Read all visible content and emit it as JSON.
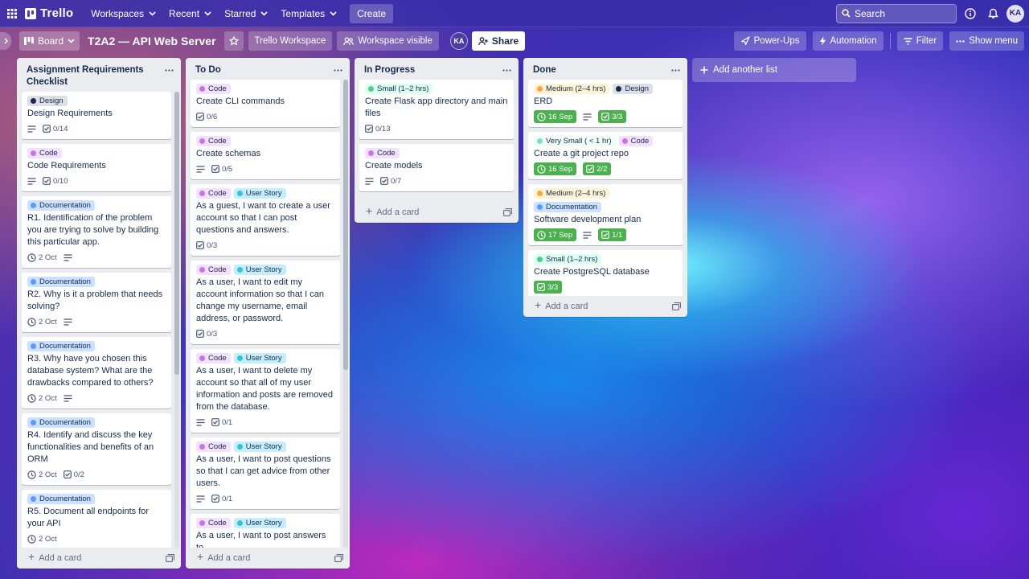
{
  "nav": {
    "logo": "Trello",
    "menus": [
      "Workspaces",
      "Recent",
      "Starred",
      "Templates"
    ],
    "create": "Create",
    "search_placeholder": "Search",
    "avatar": "KA"
  },
  "board": {
    "view": "Board",
    "title": "T2A2 — API Web Server",
    "workspace": "Trello Workspace",
    "visibility": "Workspace visible",
    "member": "KA",
    "share": "Share",
    "power_ups": "Power-Ups",
    "automation": "Automation",
    "filter": "Filter",
    "show_menu": "Show menu"
  },
  "labels_legend": {
    "Design": "#172b4d",
    "Code": "#c774e8",
    "Documentation": "#579dff",
    "User Story": "#2fc7d8",
    "Small (1–2 hrs)": "#4bce97",
    "Medium (2–4 hrs)": "#faa53d",
    "Very Small ( < 1 hr)": "#7ee2b8"
  },
  "lists": [
    {
      "title": "Assignment Requirements Checklist",
      "add_card": "Add a card",
      "cards": [
        {
          "labels": [
            {
              "name": "Design",
              "bg": "#dcdfe4",
              "dot": "#172b4d"
            }
          ],
          "title": "Design Requirements",
          "desc": true,
          "checklist": "0/14"
        },
        {
          "labels": [
            {
              "name": "Code",
              "bg": "#f3e0fa",
              "dot": "#c774e8"
            }
          ],
          "title": "Code Requirements",
          "desc": true,
          "checklist": "0/10"
        },
        {
          "labels": [
            {
              "name": "Documentation",
              "bg": "#cce0ff",
              "dot": "#579dff"
            }
          ],
          "title": "R1. Identification of the problem you are trying to solve by building this particular app.",
          "due": "2 Oct",
          "desc": true
        },
        {
          "labels": [
            {
              "name": "Documentation",
              "bg": "#cce0ff",
              "dot": "#579dff"
            }
          ],
          "title": "R2. Why is it a problem that needs solving?",
          "due": "2 Oct",
          "desc": true
        },
        {
          "labels": [
            {
              "name": "Documentation",
              "bg": "#cce0ff",
              "dot": "#579dff"
            }
          ],
          "title": "R3. Why have you chosen this database system? What are the drawbacks compared to others?",
          "due": "2 Oct",
          "desc": true
        },
        {
          "labels": [
            {
              "name": "Documentation",
              "bg": "#cce0ff",
              "dot": "#579dff"
            }
          ],
          "title": "R4. Identify and discuss the key functionalities and benefits of an ORM",
          "due": "2 Oct",
          "checklist": "0/2"
        },
        {
          "labels": [
            {
              "name": "Documentation",
              "bg": "#cce0ff",
              "dot": "#579dff"
            }
          ],
          "title": "R5. Document all endpoints for your API",
          "due": "2 Oct"
        }
      ]
    },
    {
      "title": "To Do",
      "add_card": "Add a card",
      "cards": [
        {
          "labels": [
            {
              "name": "Code",
              "bg": "#f3e0fa",
              "dot": "#c774e8"
            }
          ],
          "title": "Create CLI commands",
          "checklist": "0/6"
        },
        {
          "labels": [
            {
              "name": "Code",
              "bg": "#f3e0fa",
              "dot": "#c774e8"
            }
          ],
          "title": "Create schemas",
          "desc": true,
          "checklist": "0/5"
        },
        {
          "labels": [
            {
              "name": "Code",
              "bg": "#f3e0fa",
              "dot": "#c774e8"
            },
            {
              "name": "User Story",
              "bg": "#c6edfb",
              "dot": "#2fc7d8"
            }
          ],
          "title": "As a guest, I want to create a user account so that I can post questions and answers.",
          "checklist": "0/3"
        },
        {
          "labels": [
            {
              "name": "Code",
              "bg": "#f3e0fa",
              "dot": "#c774e8"
            },
            {
              "name": "User Story",
              "bg": "#c6edfb",
              "dot": "#2fc7d8"
            }
          ],
          "title": "As a user, I want to edit my account information so that I can change my username, email address, or password.",
          "checklist": "0/3"
        },
        {
          "labels": [
            {
              "name": "Code",
              "bg": "#f3e0fa",
              "dot": "#c774e8"
            },
            {
              "name": "User Story",
              "bg": "#c6edfb",
              "dot": "#2fc7d8"
            }
          ],
          "title": "As a user, I want to delete my account so that all of my user information and posts are removed from the database.",
          "desc": true,
          "checklist": "0/1"
        },
        {
          "labels": [
            {
              "name": "Code",
              "bg": "#f3e0fa",
              "dot": "#c774e8"
            },
            {
              "name": "User Story",
              "bg": "#c6edfb",
              "dot": "#2fc7d8"
            }
          ],
          "title": "As a user, I want to post questions so that I can get advice from other users.",
          "desc": true,
          "checklist": "0/1"
        },
        {
          "labels": [
            {
              "name": "Code",
              "bg": "#f3e0fa",
              "dot": "#c774e8"
            },
            {
              "name": "User Story",
              "bg": "#c6edfb",
              "dot": "#2fc7d8"
            }
          ],
          "title": "As a user, I want to post answers to"
        }
      ]
    },
    {
      "title": "In Progress",
      "add_card": "Add a card",
      "cards": [
        {
          "labels": [
            {
              "name": "Small (1–2 hrs)",
              "bg": "#dcfff1",
              "dot": "#4bce97"
            }
          ],
          "title": "Create Flask app directory and main files",
          "checklist": "0/13"
        },
        {
          "labels": [
            {
              "name": "Code",
              "bg": "#f3e0fa",
              "dot": "#c774e8"
            }
          ],
          "title": "Create models",
          "desc": true,
          "checklist": "0/7"
        }
      ]
    },
    {
      "title": "Done",
      "add_card": "Add a card",
      "cards": [
        {
          "labels": [
            {
              "name": "Medium (2–4 hrs)",
              "bg": "#fff3d6",
              "dot": "#faa53d"
            },
            {
              "name": "Design",
              "bg": "#dcdfe4",
              "dot": "#172b4d"
            }
          ],
          "title": "ERD",
          "due": "16 Sep",
          "due_done": true,
          "desc": true,
          "checklist": "3/3",
          "checklist_done": true
        },
        {
          "labels": [
            {
              "name": "Very Small ( < 1 hr)",
              "bg": "#f0fdf6",
              "dot": "#7ee2b8"
            },
            {
              "name": "Code",
              "bg": "#f3e0fa",
              "dot": "#c774e8"
            }
          ],
          "title": "Create a git project repo",
          "due": "16 Sep",
          "due_done": true,
          "checklist": "2/2",
          "checklist_done": true
        },
        {
          "labels": [
            {
              "name": "Medium (2–4 hrs)",
              "bg": "#fff3d6",
              "dot": "#faa53d"
            },
            {
              "name": "Documentation",
              "bg": "#cce0ff",
              "dot": "#579dff"
            }
          ],
          "title": "Software development plan",
          "due": "17 Sep",
          "due_done": true,
          "desc": true,
          "checklist": "1/1",
          "checklist_done": true
        },
        {
          "labels": [
            {
              "name": "Small (1–2 hrs)",
              "bg": "#dcfff1",
              "dot": "#4bce97"
            }
          ],
          "title": "Create PostgreSQL database",
          "checklist": "3/3",
          "checklist_done": true
        }
      ]
    }
  ],
  "add_list": "Add another list"
}
